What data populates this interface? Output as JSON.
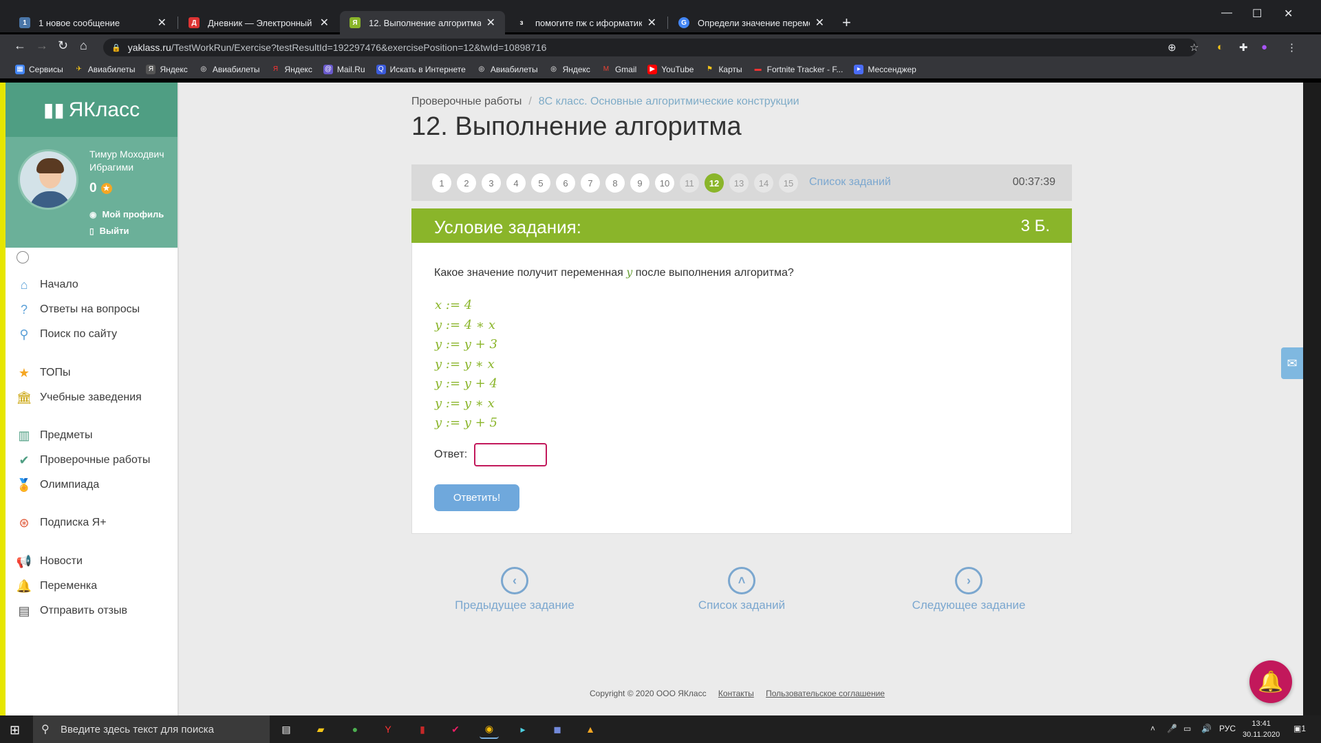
{
  "browser": {
    "tabs": [
      {
        "title": "1 новое сообщение",
        "favicon": "1",
        "favicon_color": "#4a76a8"
      },
      {
        "title": "Дневник — Электронный журнал",
        "favicon": "Д",
        "favicon_color": "#d33"
      },
      {
        "title": "12. Выполнение алгоритма",
        "favicon": "Я",
        "favicon_color": "#8ab52a"
      },
      {
        "title": "помогите пж с иформатикой - Зн",
        "favicon": "з",
        "favicon_color": "#202124"
      },
      {
        "title": "Определи значение переменной",
        "favicon": "G",
        "favicon_color": "#4285f4"
      }
    ],
    "url_host": "yaklass.ru",
    "url_path": "/TestWorkRun/Exercise?testResultId=192297476&exercisePosition=12&twId=10898716",
    "bookmarks": [
      "Сервисы",
      "Авиабилеты",
      "Яндекс",
      "Авиабилеты",
      "Яндекс",
      "Mail.Ru",
      "Искать в Интернете",
      "Авиабилеты",
      "Яндекс",
      "Gmail",
      "YouTube",
      "Карты",
      "Fortnite Tracker - F...",
      "Мессенджер"
    ]
  },
  "sidebar": {
    "logo": "ЯКласс",
    "user_name": "Тимур Моходвич Ибрагими",
    "points": "0",
    "profile_link": "Мой профиль",
    "logout_link": "Выйти",
    "menu": [
      {
        "label": "Начало",
        "icon": "home-icon"
      },
      {
        "label": "Ответы на вопросы",
        "icon": "question-icon"
      },
      {
        "label": "Поиск по сайту",
        "icon": "search-icon"
      },
      {
        "label": "ТОПы",
        "icon": "star-icon"
      },
      {
        "label": "Учебные заведения",
        "icon": "building-icon"
      },
      {
        "label": "Предметы",
        "icon": "books-icon"
      },
      {
        "label": "Проверочные работы",
        "icon": "check-icon"
      },
      {
        "label": "Олимпиада",
        "icon": "medal-icon"
      },
      {
        "label": "Подписка Я+",
        "icon": "subscription-icon"
      },
      {
        "label": "Новости",
        "icon": "megaphone-icon"
      },
      {
        "label": "Переменка",
        "icon": "bell-icon"
      },
      {
        "label": "Отправить отзыв",
        "icon": "chat-icon"
      }
    ]
  },
  "breadcrumb": {
    "root": "Проверочные работы",
    "current": "8С класс. Основные алгоритмические конструкции"
  },
  "page_title": "12. Выполнение алгоритма",
  "task_nav": {
    "numbers": [
      "1",
      "2",
      "3",
      "4",
      "5",
      "6",
      "7",
      "8",
      "9",
      "10",
      "11",
      "12",
      "13",
      "14",
      "15"
    ],
    "current": "12",
    "list_link": "Список заданий",
    "timer": "00:37:39"
  },
  "task": {
    "header": "Условие задания:",
    "points": "3 Б.",
    "question_before": "Какое значение получит переменная",
    "question_var": "y",
    "question_after": "после выполнения алгоритма?",
    "code_lines": [
      "x := 4",
      "y := 4 ∗ x",
      "y := y + 3",
      "y := y ∗ x",
      "y := y + 4",
      "y := y ∗ x",
      "y := y + 5"
    ],
    "answer_label": "Ответ:",
    "answer_value": "",
    "submit_label": "Ответить!"
  },
  "bottom_nav": {
    "prev": "Предыдущее задание",
    "list": "Список заданий",
    "next": "Следующее задание"
  },
  "footer": {
    "copyright": "Copyright © 2020 ООО ЯКласс",
    "contacts": "Контакты",
    "agreement": "Пользовательское соглашение"
  },
  "os_taskbar": {
    "search_placeholder": "Введите здесь текст для поиска",
    "lang": "РУС",
    "time": "13:41",
    "date": "30.11.2020",
    "notifications": "1"
  }
}
